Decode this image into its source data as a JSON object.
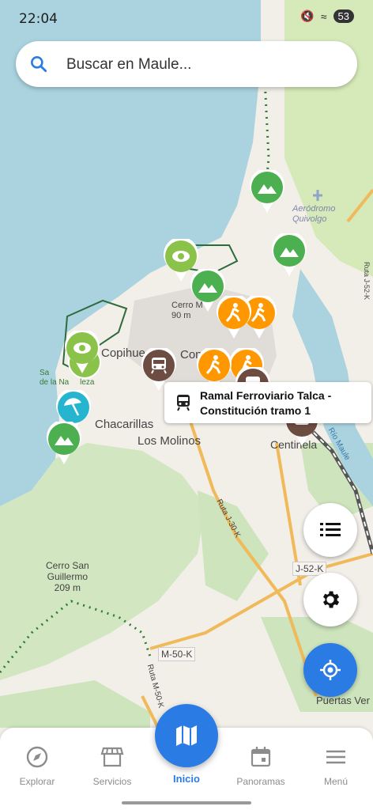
{
  "status_bar": {
    "time": "22:04",
    "battery": "53"
  },
  "search": {
    "placeholder": "Buscar en Maule..."
  },
  "map_labels": {
    "aerodromo": "Aeródromo\nQuivolgo",
    "cerro": "Cerro M\n90 m",
    "copihue": "Copihue",
    "cons": "Cons",
    "santuario": "Sa\nde la Na     leza",
    "chacarillas": "Chacarillas",
    "los_molinos": "Los Molinos",
    "centinela": "Centinela",
    "cerro_san_guillermo": "Cerro San\nGuillermo\n209 m",
    "ruta_30k": "Ruta J-30-K",
    "j52k_a": "J-52-K",
    "j52k_b": "Ruta J-52-K",
    "m50k": "M-50-K",
    "ruta_m50k": "Ruta M-50-K",
    "rio_maule": "Río Maule",
    "puertas": "Puertas Ver"
  },
  "popup": {
    "title": "Ramal Ferroviario Talca - Constitución tramo 1",
    "icon": "train-icon"
  },
  "nav": {
    "items": [
      {
        "label": "Explorar",
        "icon": "compass-icon"
      },
      {
        "label": "Servicios",
        "icon": "store-icon"
      },
      {
        "label": "Inicio",
        "icon": "map-icon"
      },
      {
        "label": "Panoramas",
        "icon": "calendar-icon"
      },
      {
        "label": "Menú",
        "icon": "menu-icon"
      }
    ]
  },
  "colors": {
    "accent": "#2b7be4",
    "pin_green": "#4caf50",
    "pin_lightgreen": "#8bc34a",
    "pin_orange": "#ff9800",
    "pin_brown": "#6d4c41",
    "pin_cyan": "#26b5cf",
    "sea": "#aad3df"
  }
}
